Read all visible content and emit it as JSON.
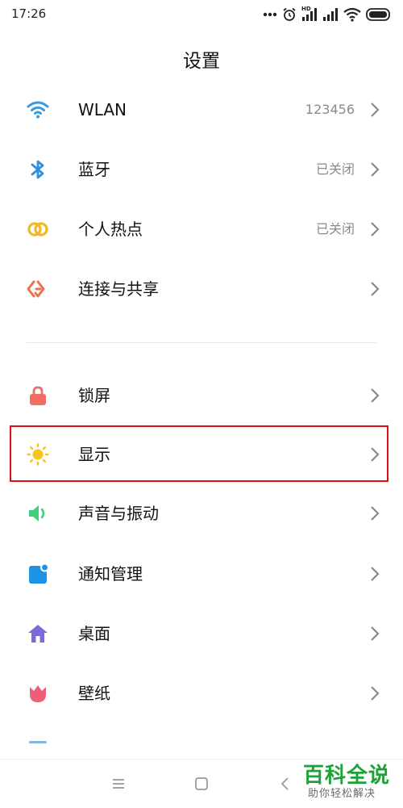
{
  "status_bar": {
    "time": "17:26",
    "hd_label": "HD",
    "icons": [
      "more-dots-icon",
      "alarm-icon",
      "signal-hd-icon",
      "signal-icon",
      "wifi-icon",
      "battery-icon"
    ]
  },
  "page": {
    "title": "设置"
  },
  "sections": [
    {
      "items": [
        {
          "id": "wlan",
          "label": "WLAN",
          "value": "123456",
          "icon": "wifi-icon",
          "color": "#3a9ad9"
        },
        {
          "id": "bluetooth",
          "label": "蓝牙",
          "value": "已关闭",
          "icon": "bluetooth-icon",
          "color": "#2f8fe0"
        },
        {
          "id": "hotspot",
          "label": "个人热点",
          "value": "已关闭",
          "icon": "hotspot-icon",
          "color": "#f2b824"
        },
        {
          "id": "connection",
          "label": "连接与共享",
          "value": "",
          "icon": "connection-share-icon",
          "color": "#e9734f"
        }
      ]
    },
    {
      "items": [
        {
          "id": "lockscreen",
          "label": "锁屏",
          "value": "",
          "icon": "lock-icon",
          "color": "#f16e66"
        },
        {
          "id": "display",
          "label": "显示",
          "value": "",
          "icon": "sun-icon",
          "color": "#f5c518",
          "highlighted": true
        },
        {
          "id": "sound",
          "label": "声音与振动",
          "value": "",
          "icon": "speaker-icon",
          "color": "#3fcf7c"
        },
        {
          "id": "notifications",
          "label": "通知管理",
          "value": "",
          "icon": "notification-icon",
          "color": "#1e93e6"
        },
        {
          "id": "desktop",
          "label": "桌面",
          "value": "",
          "icon": "home-icon",
          "color": "#7a6bdc"
        },
        {
          "id": "wallpaper",
          "label": "壁纸",
          "value": "",
          "icon": "tulip-icon",
          "color": "#ee5d7a"
        }
      ]
    }
  ],
  "highlight_color": "#d6121b",
  "nav_bar": {
    "buttons": [
      "menu-icon",
      "home-square-icon",
      "back-icon"
    ]
  },
  "watermark": {
    "title": "百科全说",
    "subtitle": "助你轻松解决",
    "color": "#1fa13a"
  }
}
